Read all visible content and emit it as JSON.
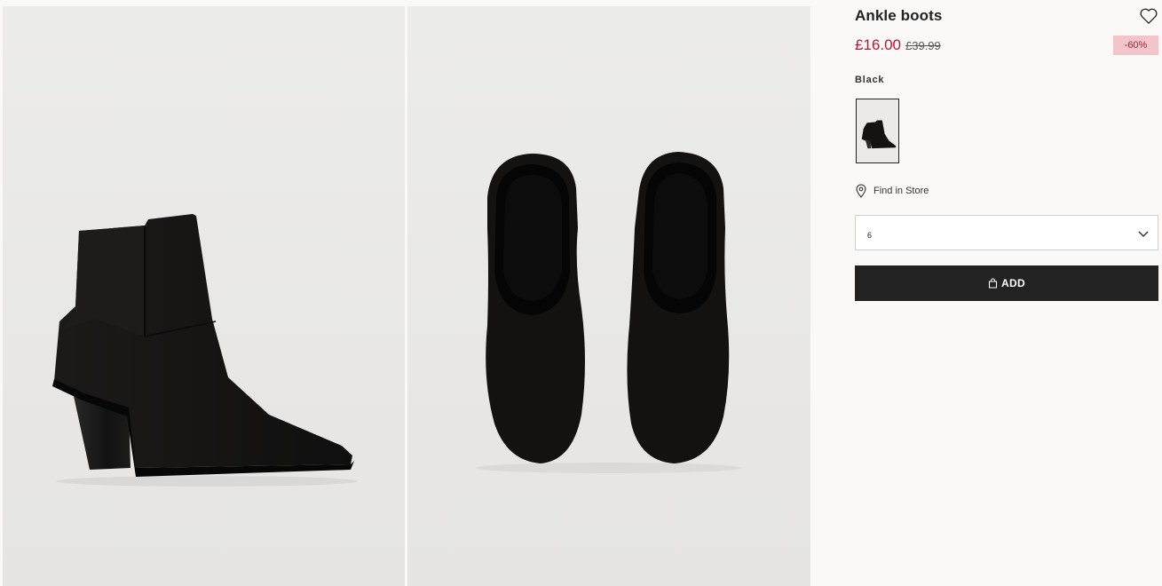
{
  "product": {
    "title": "Ankle boots",
    "price_current": "£16.00",
    "price_original": "£39.99",
    "discount_badge": "-60%",
    "color_name": "Black"
  },
  "store": {
    "label": "Find in Store"
  },
  "size_select": {
    "value": "6"
  },
  "add_button": {
    "label": "ADD"
  },
  "icons": {
    "favorite": "heart-icon",
    "store": "location-pin-icon",
    "select": "chevron-down-icon",
    "bag": "shopping-bag-icon"
  },
  "colors": {
    "sale_red": "#c8102e",
    "discount_bg": "#f2c5cb",
    "button_bg": "#222222",
    "page_bg": "#faf9f8"
  }
}
